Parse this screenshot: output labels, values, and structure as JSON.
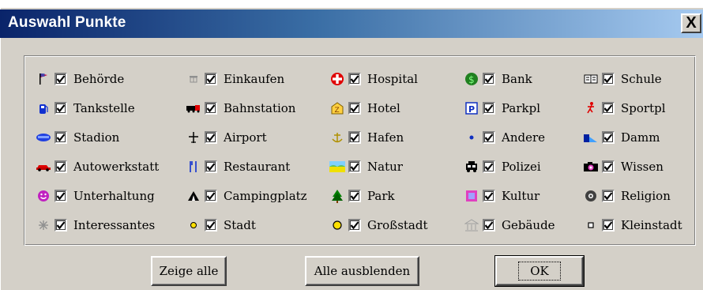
{
  "window": {
    "title": "Auswahl Punkte",
    "close_label": "X"
  },
  "colors": {
    "titlebar_start": "#0a246a",
    "titlebar_end": "#a6caf0",
    "face": "#d4d0c8"
  },
  "items": [
    {
      "label": "Behörde",
      "checked": true,
      "icon": "flag-icon"
    },
    {
      "label": "Tankstelle",
      "checked": true,
      "icon": "fuel-pump-icon"
    },
    {
      "label": "Stadion",
      "checked": true,
      "icon": "stadium-icon"
    },
    {
      "label": "Autowerkstatt",
      "checked": true,
      "icon": "car-repair-icon"
    },
    {
      "label": "Unterhaltung",
      "checked": true,
      "icon": "smiley-icon"
    },
    {
      "label": "Interessantes",
      "checked": true,
      "icon": "asterisk-icon"
    },
    {
      "label": "Einkaufen",
      "checked": true,
      "icon": "shopping-icon"
    },
    {
      "label": "Bahnstation",
      "checked": true,
      "icon": "train-icon"
    },
    {
      "label": "Airport",
      "checked": true,
      "icon": "airplane-icon"
    },
    {
      "label": "Restaurant",
      "checked": true,
      "icon": "cutlery-icon"
    },
    {
      "label": "Campingplatz",
      "checked": true,
      "icon": "tent-icon"
    },
    {
      "label": "Stadt",
      "checked": true,
      "icon": "small-circle-icon"
    },
    {
      "label": "Hospital",
      "checked": true,
      "icon": "red-cross-icon"
    },
    {
      "label": "Hotel",
      "checked": true,
      "icon": "hotel-icon"
    },
    {
      "label": "Hafen",
      "checked": true,
      "icon": "anchor-icon"
    },
    {
      "label": "Natur",
      "checked": true,
      "icon": "landscape-icon"
    },
    {
      "label": "Park",
      "checked": true,
      "icon": "tree-icon"
    },
    {
      "label": "Großstadt",
      "checked": true,
      "icon": "yellow-circle-icon"
    },
    {
      "label": "Bank",
      "checked": true,
      "icon": "money-icon"
    },
    {
      "label": "Parkpl",
      "checked": true,
      "icon": "parking-icon"
    },
    {
      "label": "Andere",
      "checked": true,
      "icon": "dot-icon"
    },
    {
      "label": "Polizei",
      "checked": true,
      "icon": "police-car-icon"
    },
    {
      "label": "Kultur",
      "checked": true,
      "icon": "culture-icon"
    },
    {
      "label": "Gebäude",
      "checked": true,
      "icon": "building-icon"
    },
    {
      "label": "Schule",
      "checked": true,
      "icon": "school-icon"
    },
    {
      "label": "Sportpl",
      "checked": true,
      "icon": "sports-icon"
    },
    {
      "label": "Damm",
      "checked": true,
      "icon": "dam-icon"
    },
    {
      "label": "Wissen",
      "checked": true,
      "icon": "camera-icon"
    },
    {
      "label": "Religion",
      "checked": true,
      "icon": "religion-icon"
    },
    {
      "label": "Kleinstadt",
      "checked": true,
      "icon": "square-dot-icon"
    }
  ],
  "buttons": {
    "show_all": "Zeige alle",
    "hide_all": "Alle ausblenden",
    "ok": "OK"
  }
}
